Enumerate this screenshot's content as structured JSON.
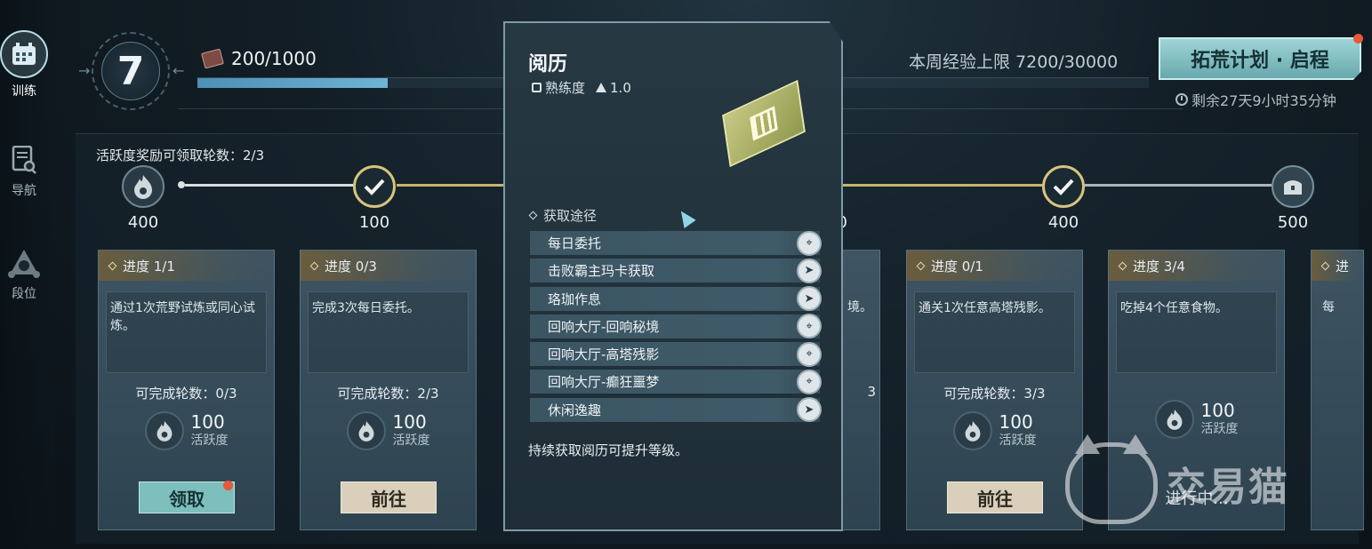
{
  "sidebar": {
    "items": [
      {
        "label": "训练",
        "icon": "calendar-icon"
      },
      {
        "label": "导航",
        "icon": "document-search-icon"
      },
      {
        "label": "段位",
        "icon": "rank-emblem-icon"
      }
    ]
  },
  "header": {
    "level": "7",
    "exp": "200/1000",
    "exp_progress": 0.2,
    "weekly_cap": "本周经验上限 7200/30000",
    "event_button": "拓荒计划 · 启程",
    "event_timer": "剩余27天9小时35分钟"
  },
  "activity": {
    "rounds_label": "活跃度奖励可领取轮数：2/3",
    "milestones": [
      "400",
      "100",
      "",
      "",
      "0",
      "400",
      "500"
    ]
  },
  "cards": [
    {
      "progress": "进度 1/1",
      "desc": "通过1次荒野试炼或同心试炼。",
      "rounds": "可完成轮数：0/3",
      "reward": "100",
      "reward_unit": "活跃度",
      "button": "领取"
    },
    {
      "progress": "进度 0/3",
      "desc": "完成3次每日委托。",
      "rounds": "可完成轮数：2/3",
      "reward": "100",
      "reward_unit": "活跃度",
      "button": "前往"
    },
    {
      "progress": "",
      "desc": "境。",
      "rounds": "3",
      "reward": "",
      "reward_unit": "",
      "button": ""
    },
    {
      "progress": "进度 0/1",
      "desc": "通关1次任意高塔残影。",
      "rounds": "可完成轮数：3/3",
      "reward": "100",
      "reward_unit": "活跃度",
      "button": "前往"
    },
    {
      "progress": "进度 3/4",
      "desc": "吃掉4个任意食物。",
      "rounds": "",
      "reward": "100",
      "reward_unit": "活跃度",
      "button": "进行中..."
    },
    {
      "progress": "进",
      "desc": "每",
      "rounds": "",
      "reward": "",
      "reward_unit": "",
      "button": ""
    }
  ],
  "popup": {
    "title": "阅历",
    "proficiency_label": "熟练度",
    "proficiency_value": "1.0",
    "sources_title": "获取途径",
    "sources": [
      {
        "label": "每日委托",
        "icon": "map-pin-icon"
      },
      {
        "label": "击败霸主玛卡获取",
        "icon": "arrow-go-icon"
      },
      {
        "label": "珞珈作息",
        "icon": "arrow-go-icon"
      },
      {
        "label": "回响大厅-回响秘境",
        "icon": "map-pin-icon"
      },
      {
        "label": "回响大厅-高塔残影",
        "icon": "map-pin-icon"
      },
      {
        "label": "回响大厅-癫狂噩梦",
        "icon": "map-pin-icon"
      },
      {
        "label": "休闲逸趣",
        "icon": "arrow-go-icon"
      }
    ],
    "footer": "持续获取阅历可提升等级。"
  },
  "watermark": "交易猫"
}
